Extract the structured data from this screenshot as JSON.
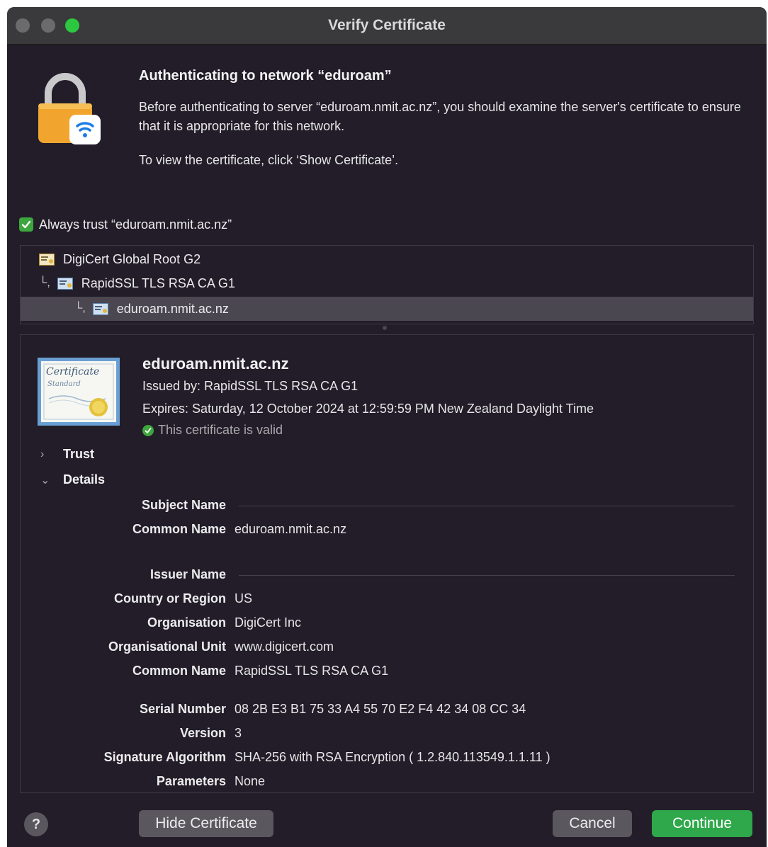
{
  "window": {
    "title": "Verify Certificate"
  },
  "header": {
    "heading": "Authenticating to network “eduroam”",
    "description": "Before authenticating to server “eduroam.nmit.ac.nz”, you should examine the server's certificate to ensure that it is appropriate for this network.",
    "instruction": "To view the certificate, click ‘Show Certificate’."
  },
  "always_trust": {
    "label": "Always trust “eduroam.nmit.ac.nz”",
    "checked": true
  },
  "chain": {
    "items": [
      {
        "label": "DigiCert Global Root G2",
        "level": 0,
        "selected": false
      },
      {
        "label": "RapidSSL TLS RSA CA G1",
        "level": 1,
        "selected": false
      },
      {
        "label": "eduroam.nmit.ac.nz",
        "level": 2,
        "selected": true
      }
    ]
  },
  "certificate": {
    "common_name": "eduroam.nmit.ac.nz",
    "issued_by": "Issued by: RapidSSL TLS RSA CA G1",
    "expires": "Expires: Saturday, 12 October 2024 at 12:59:59 PM New Zealand Daylight Time",
    "status": "This certificate is valid",
    "badge_top": "Certificate",
    "badge_bottom": "Standard"
  },
  "sections": {
    "trust": "Trust",
    "details": "Details"
  },
  "details": {
    "subject_header": "Subject Name",
    "subject": [
      {
        "label": "Common Name",
        "value": "eduroam.nmit.ac.nz"
      }
    ],
    "issuer_header": "Issuer Name",
    "issuer": [
      {
        "label": "Country or Region",
        "value": "US"
      },
      {
        "label": "Organisation",
        "value": "DigiCert Inc"
      },
      {
        "label": "Organisational Unit",
        "value": "www.digicert.com"
      },
      {
        "label": "Common Name",
        "value": "RapidSSL TLS RSA CA G1"
      }
    ],
    "other": [
      {
        "label": "Serial Number",
        "value": "08 2B E3 B1 75 33 A4 55 70 E2 F4 42 34 08 CC 34"
      },
      {
        "label": "Version",
        "value": "3"
      },
      {
        "label": "Signature Algorithm",
        "value": "SHA-256 with RSA Encryption ( 1.2.840.113549.1.1.11 )"
      },
      {
        "label": "Parameters",
        "value": "None"
      }
    ]
  },
  "buttons": {
    "help": "?",
    "hide": "Hide Certificate",
    "cancel": "Cancel",
    "continue": "Continue"
  },
  "icons": {
    "lock": "lock-wifi-icon",
    "cert": "certificate-icon",
    "valid": "checkmark-icon"
  },
  "colors": {
    "accent": "#2ea84a",
    "window_bg": "#221d28",
    "selection": "#4b4750"
  }
}
